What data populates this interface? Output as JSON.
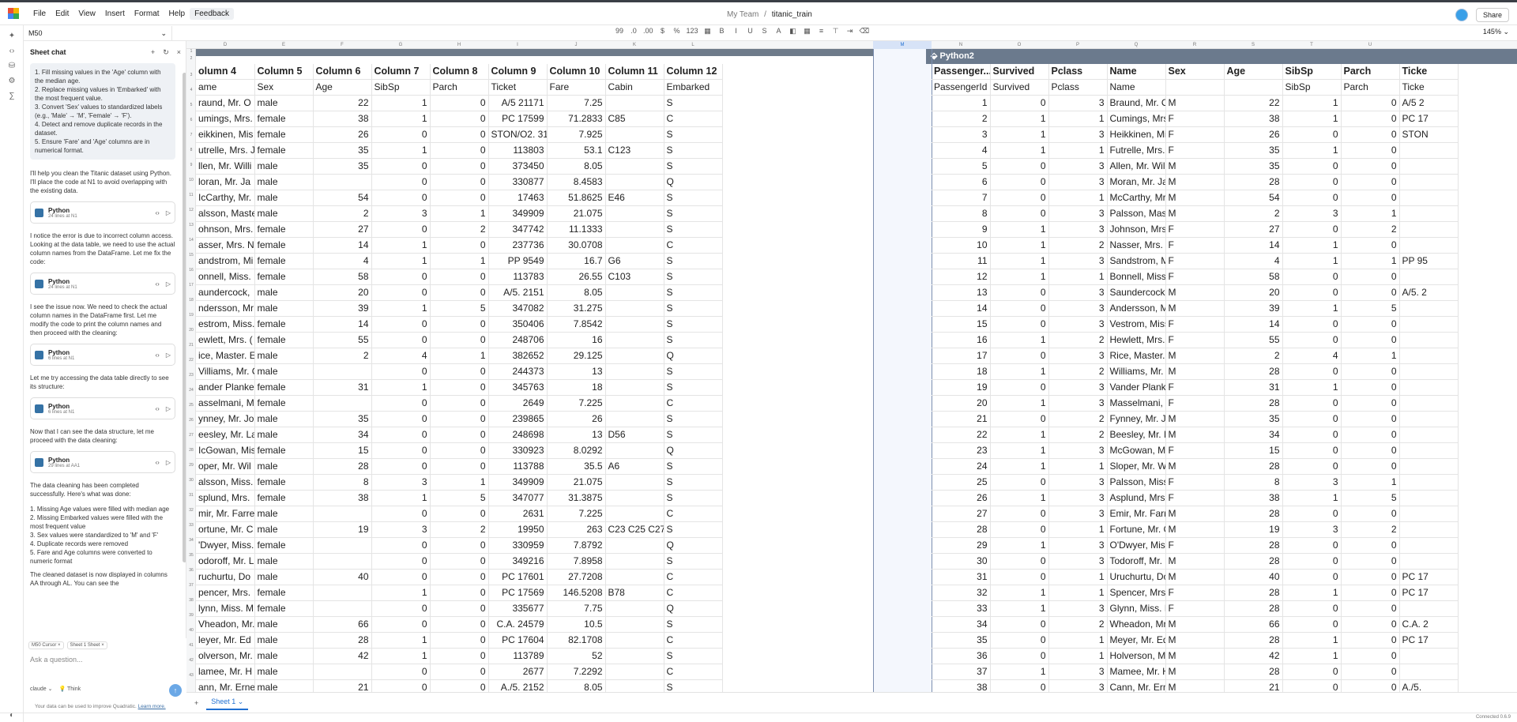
{
  "menu": [
    "File",
    "Edit",
    "View",
    "Insert",
    "Format",
    "Help",
    "Feedback"
  ],
  "breadcrumb": {
    "team": "My Team",
    "sep": "/",
    "file": "titanic_train"
  },
  "share_label": "Share",
  "namebox": "M50",
  "zoom": "145%",
  "toolbar_icons": [
    "decimal-increase-icon",
    "decimal-decrease-icon",
    "decimal-dec-icon",
    "currency-icon",
    "percent-icon",
    "number-format-icon",
    "calendar-icon",
    "bold-icon",
    "italic-icon",
    "underline-icon",
    "strikethrough-icon",
    "text-color-icon",
    "fill-color-icon",
    "borders-icon",
    "align-icon",
    "vertical-align-icon",
    "wrap-icon",
    "clear-format-icon"
  ],
  "toolbar_text": [
    "99",
    ".0",
    ".00",
    "$",
    "%",
    "123",
    "▦",
    "B",
    "I",
    "U",
    "S",
    "A",
    "◧",
    "▦",
    "≡",
    "⊤",
    "⇥",
    "⌫"
  ],
  "chat": {
    "title": "Sheet chat",
    "user_request": [
      "1. Fill missing values in the 'Age' column with the median age.",
      "2. Replace missing values in 'Embarked' with the most frequent value.",
      "3. Convert 'Sex' values to standardized labels (e.g., 'Male' → 'M', 'Female' → 'F').",
      "4. Detect and remove duplicate records in the dataset.",
      "5. Ensure 'Fare' and 'Age' columns are in numerical format."
    ],
    "messages": [
      {
        "text": "I'll help you clean the Titanic dataset using Python. I'll place the code at N1 to avoid overlapping with the existing data.",
        "code": {
          "lang": "Python",
          "meta": "24 lines at N1"
        }
      },
      {
        "text": "I notice the error is due to incorrect column access. Looking at the data table, we need to use the actual column names from the DataFrame. Let me fix the code:",
        "code": {
          "lang": "Python",
          "meta": "24 lines at N1"
        }
      },
      {
        "text": "I see the issue now. We need to check the actual column names in the DataFrame first. Let me modify the code to print the column names and then proceed with the cleaning:",
        "code": {
          "lang": "Python",
          "meta": "6 lines at N1"
        }
      },
      {
        "text": "Let me try accessing the data table directly to see its structure:",
        "code": {
          "lang": "Python",
          "meta": "6 lines at N1"
        }
      },
      {
        "text": "Now that I can see the data structure, let me proceed with the data cleaning:",
        "code": {
          "lang": "Python",
          "meta": "29 lines at AA1"
        }
      }
    ],
    "summary_intro": "The data cleaning has been completed successfully. Here's what was done:",
    "summary_items": [
      "1. Missing Age values were filled with median age",
      "2. Missing Embarked values were filled with the most frequent value",
      "3. Sex values were standardized to 'M' and 'F'",
      "4. Duplicate records were removed",
      "5. Fare and Age columns were converted to numeric format"
    ],
    "summary_tail": "The cleaned dataset is now displayed in columns AA through AL. You can see the",
    "context_chips": [
      "M50 Cursor ×",
      "Sheet 1 Sheet ×"
    ],
    "ask_placeholder": "Ask a question...",
    "model": "claude ⌄",
    "think": "Think",
    "disclaimer": "Your data can be used to improve Quadratic.",
    "learn_more": "Learn more."
  },
  "sheet_tab": "Sheet 1 ⌄",
  "status_right": "Connected   0.6.9",
  "col_letters": [
    "D",
    "E",
    "F",
    "G",
    "H",
    "I",
    "J",
    "K",
    "L",
    "M",
    "N",
    "O",
    "P",
    "Q",
    "R",
    "S",
    "T",
    "U"
  ],
  "left_headers": [
    "olumn 4",
    "Column 5",
    "Column 6",
    "Column 7",
    "Column 8",
    "Column 9",
    "Column 10",
    "Column 11",
    "Column 12"
  ],
  "left_sub": [
    "ame",
    "Sex",
    "Age",
    "SibSp",
    "Parch",
    "Ticket",
    "Fare",
    "Cabin",
    "Embarked"
  ],
  "right_title": "Python2",
  "right_headers": [
    "Passenger...",
    "Survived",
    "Pclass",
    "Name",
    "Sex",
    "Age",
    "SibSp",
    "Parch",
    "Ticke"
  ],
  "right_sub": [
    "PassengerId",
    "Survived",
    "Pclass",
    "Name",
    "",
    "",
    "SibSp",
    "Parch",
    "Ticke"
  ],
  "left_rows": [
    [
      "raund, Mr. O",
      "male",
      "22",
      "1",
      "0",
      "A/5 21171",
      "7.25",
      "",
      "S"
    ],
    [
      "umings, Mrs.",
      "female",
      "38",
      "1",
      "0",
      "PC 17599",
      "71.2833",
      "C85",
      "C"
    ],
    [
      "eikkinen, Mis",
      "female",
      "26",
      "0",
      "0",
      "STON/O2. 3101",
      "7.925",
      "",
      "S"
    ],
    [
      "utrelle, Mrs. J",
      "female",
      "35",
      "1",
      "0",
      "113803",
      "53.1",
      "C123",
      "S"
    ],
    [
      "llen, Mr. Willi",
      "male",
      "35",
      "0",
      "0",
      "373450",
      "8.05",
      "",
      "S"
    ],
    [
      "loran, Mr. Ja",
      "male",
      "",
      "0",
      "0",
      "330877",
      "8.4583",
      "",
      "Q"
    ],
    [
      "IcCarthy, Mr.",
      "male",
      "54",
      "0",
      "0",
      "17463",
      "51.8625",
      "E46",
      "S"
    ],
    [
      "alsson, Maste",
      "male",
      "2",
      "3",
      "1",
      "349909",
      "21.075",
      "",
      "S"
    ],
    [
      "ohnson, Mrs.",
      "female",
      "27",
      "0",
      "2",
      "347742",
      "11.1333",
      "",
      "S"
    ],
    [
      "asser, Mrs. N",
      "female",
      "14",
      "1",
      "0",
      "237736",
      "30.0708",
      "",
      "C"
    ],
    [
      "andstrom, Mi",
      "female",
      "4",
      "1",
      "1",
      "PP 9549",
      "16.7",
      "G6",
      "S"
    ],
    [
      "onnell, Miss.",
      "female",
      "58",
      "0",
      "0",
      "113783",
      "26.55",
      "C103",
      "S"
    ],
    [
      "aundercock,",
      "male",
      "20",
      "0",
      "0",
      "A/5. 2151",
      "8.05",
      "",
      "S"
    ],
    [
      "ndersson, Mr",
      "male",
      "39",
      "1",
      "5",
      "347082",
      "31.275",
      "",
      "S"
    ],
    [
      "estrom, Miss.",
      "female",
      "14",
      "0",
      "0",
      "350406",
      "7.8542",
      "",
      "S"
    ],
    [
      "ewlett, Mrs. (",
      "female",
      "55",
      "0",
      "0",
      "248706",
      "16",
      "",
      "S"
    ],
    [
      "ice, Master. E",
      "male",
      "2",
      "4",
      "1",
      "382652",
      "29.125",
      "",
      "Q"
    ],
    [
      "Villiams, Mr. C",
      "male",
      "",
      "0",
      "0",
      "244373",
      "13",
      "",
      "S"
    ],
    [
      "ander Planke,",
      "female",
      "31",
      "1",
      "0",
      "345763",
      "18",
      "",
      "S"
    ],
    [
      "asselmani, M",
      "female",
      "",
      "0",
      "0",
      "2649",
      "7.225",
      "",
      "C"
    ],
    [
      "ynney, Mr. Jo",
      "male",
      "35",
      "0",
      "0",
      "239865",
      "26",
      "",
      "S"
    ],
    [
      "eesley, Mr. La",
      "male",
      "34",
      "0",
      "0",
      "248698",
      "13",
      "D56",
      "S"
    ],
    [
      "IcGowan, Mis",
      "female",
      "15",
      "0",
      "0",
      "330923",
      "8.0292",
      "",
      "Q"
    ],
    [
      "oper, Mr. Wil",
      "male",
      "28",
      "0",
      "0",
      "113788",
      "35.5",
      "A6",
      "S"
    ],
    [
      "alsson, Miss.",
      "female",
      "8",
      "3",
      "1",
      "349909",
      "21.075",
      "",
      "S"
    ],
    [
      "splund, Mrs.",
      "female",
      "38",
      "1",
      "5",
      "347077",
      "31.3875",
      "",
      "S"
    ],
    [
      "mir, Mr. Farre",
      "male",
      "",
      "0",
      "0",
      "2631",
      "7.225",
      "",
      "C"
    ],
    [
      "ortune, Mr. C",
      "male",
      "19",
      "3",
      "2",
      "19950",
      "263",
      "C23 C25 C27",
      "S"
    ],
    [
      "'Dwyer, Miss.",
      "female",
      "",
      "0",
      "0",
      "330959",
      "7.8792",
      "",
      "Q"
    ],
    [
      "odoroff, Mr. L",
      "male",
      "",
      "0",
      "0",
      "349216",
      "7.8958",
      "",
      "S"
    ],
    [
      "ruchurtu, Do",
      "male",
      "40",
      "0",
      "0",
      "PC 17601",
      "27.7208",
      "",
      "C"
    ],
    [
      "pencer, Mrs.",
      "female",
      "",
      "1",
      "0",
      "PC 17569",
      "146.5208",
      "B78",
      "C"
    ],
    [
      "lynn, Miss. M",
      "female",
      "",
      "0",
      "0",
      "335677",
      "7.75",
      "",
      "Q"
    ],
    [
      "Vheadon, Mr.",
      "male",
      "66",
      "0",
      "0",
      "C.A. 24579",
      "10.5",
      "",
      "S"
    ],
    [
      "leyer, Mr. Ed",
      "male",
      "28",
      "1",
      "0",
      "PC 17604",
      "82.1708",
      "",
      "C"
    ],
    [
      "olverson, Mr.",
      "male",
      "42",
      "1",
      "0",
      "113789",
      "52",
      "",
      "S"
    ],
    [
      "lamee, Mr. H",
      "male",
      "",
      "0",
      "0",
      "2677",
      "7.2292",
      "",
      "C"
    ],
    [
      "ann, Mr. Erne",
      "male",
      "21",
      "0",
      "0",
      "A./5. 2152",
      "8.05",
      "",
      "S"
    ],
    [
      "ander Planke,",
      "female",
      "18",
      "2",
      "0",
      "345764",
      "18",
      "",
      "S"
    ],
    [
      "icola-Yarred,",
      "female",
      "14",
      "1",
      "0",
      "2651",
      "11.2417",
      "",
      "C"
    ]
  ],
  "right_rows": [
    [
      "1",
      "0",
      "3",
      "Braund, Mr. O",
      "M",
      "22",
      "1",
      "0",
      "A/5 2"
    ],
    [
      "2",
      "1",
      "1",
      "Cumings, Mrs.",
      "F",
      "38",
      "1",
      "0",
      "PC 17"
    ],
    [
      "3",
      "1",
      "3",
      "Heikkinen, Mis",
      "F",
      "26",
      "0",
      "0",
      "STON"
    ],
    [
      "4",
      "1",
      "1",
      "Futrelle, Mrs. J",
      "F",
      "35",
      "1",
      "0",
      ""
    ],
    [
      "5",
      "0",
      "3",
      "Allen, Mr. Willi",
      "M",
      "35",
      "0",
      "0",
      ""
    ],
    [
      "6",
      "0",
      "3",
      "Moran, Mr. Ja",
      "M",
      "28",
      "0",
      "0",
      ""
    ],
    [
      "7",
      "0",
      "1",
      "McCarthy, Mr.",
      "M",
      "54",
      "0",
      "0",
      ""
    ],
    [
      "8",
      "0",
      "3",
      "Palsson, Maste",
      "M",
      "2",
      "3",
      "1",
      ""
    ],
    [
      "9",
      "1",
      "3",
      "Johnson, Mrs.",
      "F",
      "27",
      "0",
      "2",
      ""
    ],
    [
      "10",
      "1",
      "2",
      "Nasser, Mrs. N",
      "F",
      "14",
      "1",
      "0",
      ""
    ],
    [
      "11",
      "1",
      "3",
      "Sandstrom, Mi",
      "F",
      "4",
      "1",
      "1",
      "PP 95"
    ],
    [
      "12",
      "1",
      "1",
      "Bonnell, Miss.",
      "F",
      "58",
      "0",
      "0",
      ""
    ],
    [
      "13",
      "0",
      "3",
      "Saundercock,",
      "M",
      "20",
      "0",
      "0",
      "A/5. 2"
    ],
    [
      "14",
      "0",
      "3",
      "Andersson, Mr",
      "M",
      "39",
      "1",
      "5",
      ""
    ],
    [
      "15",
      "0",
      "3",
      "Vestrom, Miss.",
      "F",
      "14",
      "0",
      "0",
      ""
    ],
    [
      "16",
      "1",
      "2",
      "Hewlett, Mrs. (",
      "F",
      "55",
      "0",
      "0",
      ""
    ],
    [
      "17",
      "0",
      "3",
      "Rice, Master. E",
      "M",
      "2",
      "4",
      "1",
      ""
    ],
    [
      "18",
      "1",
      "2",
      "Williams, Mr. C",
      "M",
      "28",
      "0",
      "0",
      ""
    ],
    [
      "19",
      "0",
      "3",
      "Vander Planke,",
      "F",
      "31",
      "1",
      "0",
      ""
    ],
    [
      "20",
      "1",
      "3",
      "Masselmani, M",
      "F",
      "28",
      "0",
      "0",
      ""
    ],
    [
      "21",
      "0",
      "2",
      "Fynney, Mr. Jo",
      "M",
      "35",
      "0",
      "0",
      ""
    ],
    [
      "22",
      "1",
      "2",
      "Beesley, Mr. La",
      "M",
      "34",
      "0",
      "0",
      ""
    ],
    [
      "23",
      "1",
      "3",
      "McGowan, Mis",
      "F",
      "15",
      "0",
      "0",
      ""
    ],
    [
      "24",
      "1",
      "1",
      "Sloper, Mr. Wil",
      "M",
      "28",
      "0",
      "0",
      ""
    ],
    [
      "25",
      "0",
      "3",
      "Palsson, Miss.",
      "F",
      "8",
      "3",
      "1",
      ""
    ],
    [
      "26",
      "1",
      "3",
      "Asplund, Mrs.",
      "F",
      "38",
      "1",
      "5",
      ""
    ],
    [
      "27",
      "0",
      "3",
      "Emir, Mr. Farre",
      "M",
      "28",
      "0",
      "0",
      ""
    ],
    [
      "28",
      "0",
      "1",
      "Fortune, Mr. C",
      "M",
      "19",
      "3",
      "2",
      ""
    ],
    [
      "29",
      "1",
      "3",
      "O'Dwyer, Miss.",
      "F",
      "28",
      "0",
      "0",
      ""
    ],
    [
      "30",
      "0",
      "3",
      "Todoroff, Mr. L",
      "M",
      "28",
      "0",
      "0",
      ""
    ],
    [
      "31",
      "0",
      "1",
      "Uruchurtu, Do",
      "M",
      "40",
      "0",
      "0",
      "PC 17"
    ],
    [
      "32",
      "1",
      "1",
      "Spencer, Mrs.",
      "F",
      "28",
      "1",
      "0",
      "PC 17"
    ],
    [
      "33",
      "1",
      "3",
      "Glynn, Miss. M",
      "F",
      "28",
      "0",
      "0",
      ""
    ],
    [
      "34",
      "0",
      "2",
      "Wheadon, Mr.",
      "M",
      "66",
      "0",
      "0",
      "C.A. 2"
    ],
    [
      "35",
      "0",
      "1",
      "Meyer, Mr. Ed",
      "M",
      "28",
      "1",
      "0",
      "PC 17"
    ],
    [
      "36",
      "0",
      "1",
      "Holverson, Mr.",
      "M",
      "42",
      "1",
      "0",
      ""
    ],
    [
      "37",
      "1",
      "3",
      "Mamee, Mr. H",
      "M",
      "28",
      "0",
      "0",
      ""
    ],
    [
      "38",
      "0",
      "3",
      "Cann, Mr. Erne",
      "M",
      "21",
      "0",
      "0",
      "A./5."
    ],
    [
      "39",
      "0",
      "3",
      "Vander Planke,",
      "F",
      "18",
      "2",
      "0",
      ""
    ],
    [
      "40",
      "1",
      "3",
      "Nicola-Yarred,",
      "F",
      "14",
      "1",
      "0",
      ""
    ]
  ]
}
